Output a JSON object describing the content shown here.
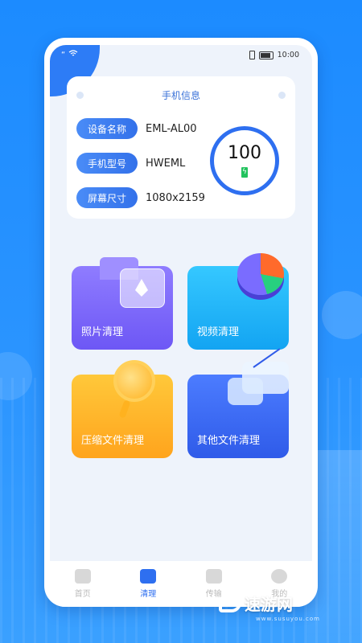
{
  "status": {
    "time": "10:00"
  },
  "info_card": {
    "title": "手机信息",
    "rows": [
      {
        "label": "设备名称",
        "value": "EML-AL00"
      },
      {
        "label": "手机型号",
        "value": "HWEML"
      },
      {
        "label": "屏幕尺寸",
        "value": "1080x2159"
      }
    ],
    "battery": {
      "value": "100",
      "icon": "charging-bolt-icon"
    }
  },
  "tiles": [
    {
      "label": "照片清理",
      "color": "#7a66f8"
    },
    {
      "label": "视频清理",
      "color": "#20b4f6"
    },
    {
      "label": "压缩文件清理",
      "color": "#ffb32a"
    },
    {
      "label": "其他文件清理",
      "color": "#3d6cf4"
    }
  ],
  "tabbar": [
    {
      "label": "首页",
      "icon": "home-icon",
      "active": false
    },
    {
      "label": "清理",
      "icon": "broom-icon",
      "active": true
    },
    {
      "label": "传输",
      "icon": "folder-icon",
      "active": false
    },
    {
      "label": "我的",
      "icon": "profile-icon",
      "active": false
    }
  ],
  "watermark": {
    "text": "速游网",
    "sub": "www.susuyou.com"
  },
  "colors": {
    "accent": "#2e6ff0",
    "background": "#1c8bff"
  }
}
